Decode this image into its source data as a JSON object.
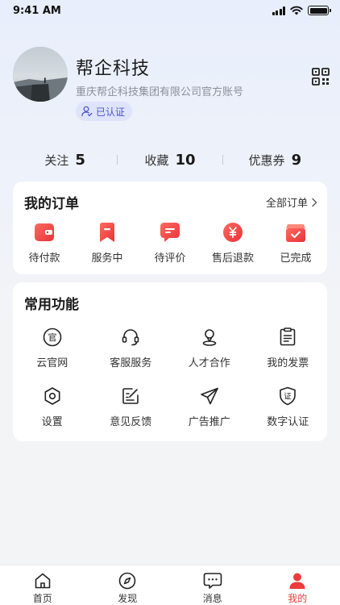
{
  "status_bar": {
    "time": "9:41 AM"
  },
  "profile": {
    "name": "帮企科技",
    "subtitle": "重庆帮企科技集团有限公司官方账号",
    "badge": "已认证"
  },
  "stats": [
    {
      "label": "关注",
      "value": "5"
    },
    {
      "label": "收藏",
      "value": "10"
    },
    {
      "label": "优惠券",
      "value": "9"
    }
  ],
  "orders": {
    "title": "我的订单",
    "link": "全部订单",
    "items": [
      {
        "label": "待付款",
        "icon": "wallet-icon"
      },
      {
        "label": "服务中",
        "icon": "bookmark-icon"
      },
      {
        "label": "待评价",
        "icon": "comment-icon"
      },
      {
        "label": "售后退款",
        "icon": "yen-refund-icon"
      },
      {
        "label": "已完成",
        "icon": "package-check-icon"
      }
    ]
  },
  "tools": {
    "title": "常用功能",
    "items": [
      {
        "label": "云官网",
        "icon": "official-site-icon",
        "glyph": "官"
      },
      {
        "label": "客服服务",
        "icon": "headset-icon"
      },
      {
        "label": "人才合作",
        "icon": "person-location-icon"
      },
      {
        "label": "我的发票",
        "icon": "invoice-icon"
      },
      {
        "label": "设置",
        "icon": "gear-icon"
      },
      {
        "label": "意见反馈",
        "icon": "feedback-edit-icon"
      },
      {
        "label": "广告推广",
        "icon": "paper-plane-icon"
      },
      {
        "label": "数字认证",
        "icon": "certificate-shield-icon",
        "glyph": "证"
      }
    ]
  },
  "tabbar": [
    {
      "label": "首页",
      "icon": "home-icon"
    },
    {
      "label": "发现",
      "icon": "compass-icon"
    },
    {
      "label": "消息",
      "icon": "message-icon"
    },
    {
      "label": "我的",
      "icon": "user-icon"
    }
  ],
  "colors": {
    "accent_red": "#ee3b3b",
    "badge_bg": "#dfe3fb",
    "badge_text": "#4a56c9"
  }
}
